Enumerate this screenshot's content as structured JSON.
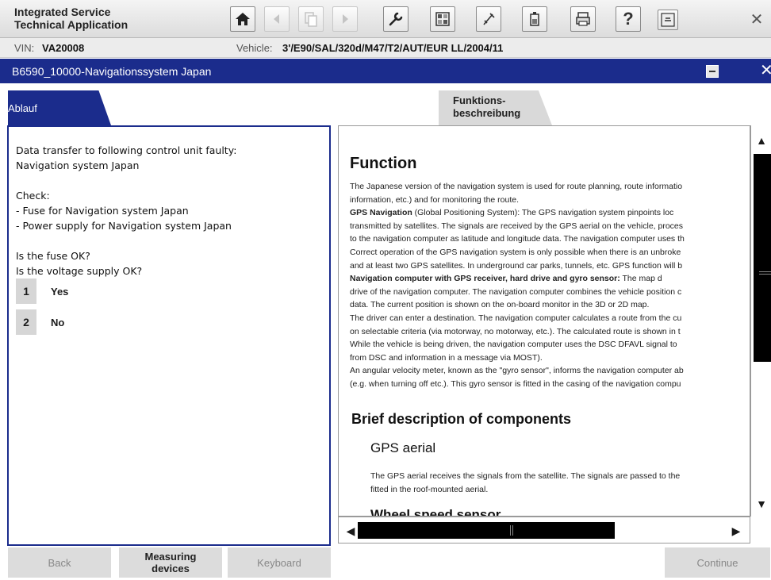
{
  "app": {
    "title_line1": "Integrated Service",
    "title_line2": "Technical Application"
  },
  "toolbar": {
    "buttons": [
      {
        "name": "home",
        "icon": "home-icon",
        "enabled": true
      },
      {
        "name": "back",
        "icon": "arrow-left-icon",
        "enabled": false
      },
      {
        "name": "documents",
        "icon": "documents-icon",
        "enabled": false
      },
      {
        "name": "forward",
        "icon": "arrow-right-icon",
        "enabled": false
      },
      {
        "name": "service",
        "icon": "wrench-icon",
        "enabled": true
      },
      {
        "name": "diagnosis",
        "icon": "control-unit-icon",
        "enabled": true
      },
      {
        "name": "measure",
        "icon": "probe-icon",
        "enabled": true
      },
      {
        "name": "battery",
        "icon": "battery-icon",
        "enabled": true
      },
      {
        "name": "print",
        "icon": "printer-icon",
        "enabled": true
      },
      {
        "name": "help",
        "icon": "help-icon",
        "label": "?",
        "enabled": true
      },
      {
        "name": "minimize",
        "icon": "minimize-icon",
        "enabled": true
      },
      {
        "name": "close",
        "icon": "close-icon",
        "label": "✕",
        "enabled": true
      }
    ]
  },
  "vehicle": {
    "vin_label": "VIN:",
    "vin": "VA20008",
    "vehicle_label": "Vehicle:",
    "vehicle": "3'/E90/SAL/320d/M47/T2/AUT/EUR LL/2004/11"
  },
  "title_bar": {
    "title": "B6590_10000-Navigationssystem Japan",
    "minimize_icon": "minimize-icon",
    "close_icon": "close-icon",
    "close_label": "✕"
  },
  "tabs": {
    "ablauf": "Ablauf",
    "funktion_line1": "Funktions-",
    "funktion_line2": "beschreibung"
  },
  "left_panel": {
    "text": "Data transfer to following control unit faulty:\nNavigation system Japan\n\nCheck:\n- Fuse for Navigation system Japan\n- Power supply for Navigation system Japan\n\nIs the fuse OK?\nIs the voltage supply OK?",
    "options": [
      {
        "number": "1",
        "label": "Yes"
      },
      {
        "number": "2",
        "label": "No"
      }
    ]
  },
  "document": {
    "heading": "Function",
    "lines": [
      {
        "text": "The Japanese version of the navigation system is used for route planning, route informatio"
      },
      {
        "text": "information, etc.) and for monitoring the route."
      },
      {
        "bold": "GPS Navigation",
        "text": " (Global Positioning System): The GPS navigation system pinpoints loc"
      },
      {
        "text": "transmitted by satellites. The signals are received by the GPS aerial on the vehicle, proces"
      },
      {
        "text": "to the navigation computer as latitude and longitude data. The navigation computer uses th"
      },
      {
        "text": "Correct operation of the GPS navigation system is only possible when there is an unbroke"
      },
      {
        "text": "and at least two GPS satellites. In underground car parks, tunnels, etc. GPS function will b"
      },
      {
        "bold": "Navigation computer with GPS receiver, hard drive and gyro sensor:",
        "text": " The map d"
      },
      {
        "text": "drive of the navigation computer. The navigation computer combines the vehicle position c"
      },
      {
        "text": "data. The current position is shown on the on-board monitor in the 3D or 2D map."
      },
      {
        "text": "The driver can enter a destination. The navigation computer calculates a route from the cu"
      },
      {
        "text": "on selectable criteria (via motorway, no motorway, etc.). The calculated route is shown in t"
      },
      {
        "text": "While the vehicle is being driven, the navigation computer uses the DSC DFAVL signal to"
      },
      {
        "text": "from DSC and information in a message via MOST)."
      },
      {
        "text": "An angular velocity meter, known as the \"gyro sensor\", informs the navigation computer ab"
      },
      {
        "text": "(e.g. when turning off etc.). This gyro sensor is fitted in the casing of the navigation compu"
      }
    ],
    "section_heading": "Brief description of components",
    "sub_heading_1": "GPS aerial",
    "gps_text_line1": "The GPS aerial receives the signals from the satellite. The signals are passed to the",
    "gps_text_line2": "fitted in the roof-mounted aerial.",
    "sub_heading_2": "Wheel speed sensor"
  },
  "scrollbars": {
    "up_arrow": "▲",
    "down_arrow": "▼",
    "left_arrow": "◀",
    "right_arrow": "▶"
  },
  "bottom": {
    "back": "Back",
    "measuring_line1": "Measuring",
    "measuring_line2": "devices",
    "keyboard": "Keyboard",
    "continue": "Continue"
  }
}
